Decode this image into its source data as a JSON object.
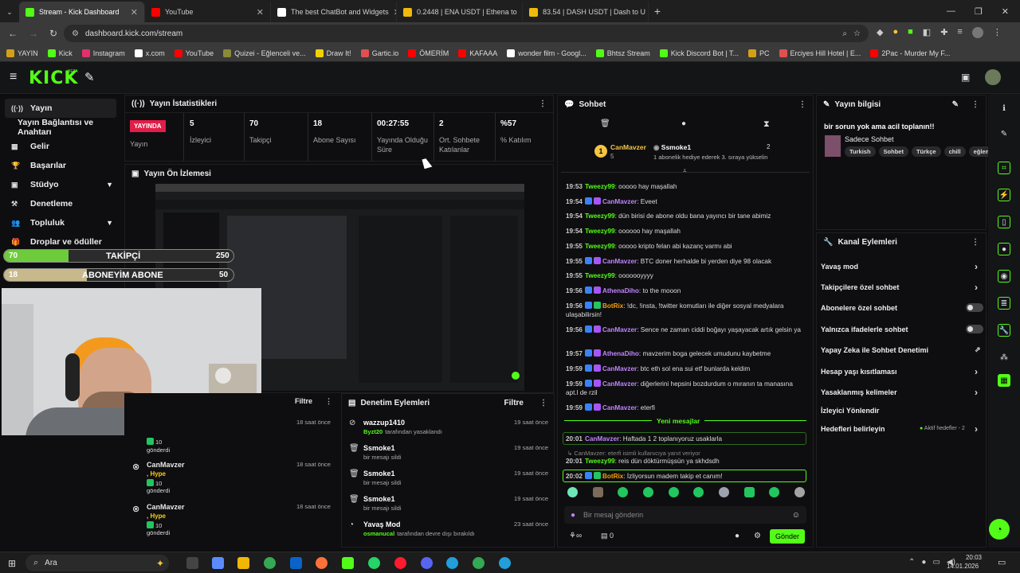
{
  "browser": {
    "tabs": [
      {
        "label": "Stream - Kick Dashboard",
        "color": "#53fc18",
        "active": true
      },
      {
        "label": "YouTube",
        "color": "#ff0000"
      },
      {
        "label": "The best ChatBot and Widgets",
        "color": "#ffffff"
      },
      {
        "label": "0.2448 | ENA USDT | Ethena to",
        "color": "#f0b90b"
      },
      {
        "label": "83.54 | DASH USDT | Dash to U",
        "color": "#f0b90b"
      }
    ],
    "new_tab": "+",
    "url": "dashboard.kick.com/stream",
    "bookmarks": [
      {
        "label": "YAYIN",
        "color": "#d4a017"
      },
      {
        "label": "Kick",
        "color": "#53fc18"
      },
      {
        "label": "Instagram",
        "color": "#e1306c"
      },
      {
        "label": "x.com",
        "color": "#ffffff"
      },
      {
        "label": "YouTube",
        "color": "#ff0000"
      },
      {
        "label": "Quizei - Eğlenceli ve...",
        "color": "#8a8a3a"
      },
      {
        "label": "Draw It!",
        "color": "#f5d000"
      },
      {
        "label": "Gartic.io",
        "color": "#e05050"
      },
      {
        "label": "ÖMERİM",
        "color": "#ff0000"
      },
      {
        "label": "KAFAAA",
        "color": "#ff0000"
      },
      {
        "label": "wonder film - Googl...",
        "color": "#ffffff"
      },
      {
        "label": "Bhtsz Stream",
        "color": "#53fc18"
      },
      {
        "label": "Kick Discord Bot | T...",
        "color": "#53fc18"
      },
      {
        "label": "PC",
        "color": "#d4a017"
      },
      {
        "label": "Erciyes Hill Hotel | E...",
        "color": "#e05050"
      },
      {
        "label": "2Pac - Murder My F...",
        "color": "#ff0000"
      }
    ]
  },
  "app": {
    "logo": "KICK",
    "logo_badge": "BETA"
  },
  "sidebar": {
    "items": [
      {
        "label": "Yayın",
        "icon": "broadcast-icon",
        "active": true
      },
      {
        "label": "Yayın Bağlantısı ve Anahtarı",
        "icon": ""
      },
      {
        "label": "Gelir",
        "icon": "chart-icon"
      },
      {
        "label": "Başarılar",
        "icon": "trophy-icon"
      },
      {
        "label": "Stüdyo",
        "icon": "studio-icon",
        "chevron": true
      },
      {
        "label": "Denetleme",
        "icon": "hammer-icon"
      },
      {
        "label": "Topluluk",
        "icon": "people-icon",
        "chevron": true
      },
      {
        "label": "Droplar ve ödüller",
        "icon": "gift-icon"
      }
    ]
  },
  "overlay": {
    "follow_goal": {
      "current": "70",
      "label": "TAKİPÇİ",
      "target": "250",
      "progress": 0.28
    },
    "sub_goal": {
      "current": "18",
      "label": "ABONEYİM ABONE",
      "target": "50",
      "progress": 0.36
    }
  },
  "stats": {
    "title": "Yayın İstatistikleri",
    "live_badge": "YAYINDA",
    "live_label": "Yayın",
    "items": [
      {
        "value": "5",
        "label": "İzleyici"
      },
      {
        "value": "70",
        "label": "Takipçi"
      },
      {
        "value": "18",
        "label": "Abone Sayısı"
      },
      {
        "value": "00:27:55",
        "label": "Yayında Olduğu Süre"
      },
      {
        "value": "2",
        "label": "Ort. Sohbete Katılanlar"
      },
      {
        "value": "%57",
        "label": "% Katılım"
      }
    ]
  },
  "preview": {
    "title": "Yayın Ön İzlemesi"
  },
  "activity": {
    "filter": "Filtre",
    "items": [
      {
        "time": "18 saat önce",
        "amount": "10",
        "label": "gönderdi"
      },
      {
        "name": "CanMavzer",
        "tag": ", Hype",
        "amount": "10",
        "label": "gönderdi",
        "time": "18 saat önce"
      },
      {
        "name": "CanMavzer",
        "tag": ", Hype",
        "amount": "10",
        "label": "gönderdi",
        "time": "18 saat önce"
      }
    ]
  },
  "moderation": {
    "title": "Denetim Eylemleri",
    "filter": "Filtre",
    "items": [
      {
        "name": "wazzup1410",
        "by": "Byzt20",
        "desc": "tarafından yasaklandı",
        "time": "19 saat önce",
        "icon": "ban-icon"
      },
      {
        "name": "Ssmoke1",
        "desc": "bir mesajı sildi",
        "time": "19 saat önce",
        "icon": "trash-icon"
      },
      {
        "name": "Ssmoke1",
        "desc": "bir mesajı sildi",
        "time": "19 saat önce",
        "icon": "trash-icon"
      },
      {
        "name": "Ssmoke1",
        "desc": "bir mesajı sildi",
        "time": "19 saat önce",
        "icon": "trash-icon"
      },
      {
        "name": "Yavaş Mod",
        "by": "osmanucal",
        "desc": "tarafından devre dışı bırakıldı",
        "time": "23 saat önce",
        "icon": "slow-icon"
      }
    ]
  },
  "chat": {
    "title": "Sohbet",
    "pinned": {
      "user1": "CanMavzer",
      "count1": "5",
      "user2": "Ssmoke1",
      "count2": "2",
      "note": "1 abonelik hediye ederek 3. sıraya yükselin",
      "rank": "1"
    },
    "messages": [
      {
        "time": "19:53",
        "user": "Tweezy99",
        "color": "gn",
        "text": "ooooo hay maşallah"
      },
      {
        "time": "19:54",
        "user": "CanMavzer",
        "color": "pu",
        "text": "Eveet",
        "badges": true
      },
      {
        "time": "19:54",
        "user": "Tweezy99",
        "color": "gn",
        "text": "dün birisi de abone oldu bana yayıncı bir tane abimiz"
      },
      {
        "time": "19:54",
        "user": "Tweezy99",
        "color": "gn",
        "text": "oooooo hay maşallah"
      },
      {
        "time": "19:55",
        "user": "Tweezy99",
        "color": "gn",
        "text": "ooooo kripto felan abi kazanç varmı abi"
      },
      {
        "time": "19:55",
        "user": "CanMavzer",
        "color": "pu",
        "text": "BTC doner herhalde bi yerden diye 98 olacak",
        "badges": true
      },
      {
        "time": "19:55",
        "user": "Tweezy99",
        "color": "gn",
        "text": "ooooooyyyy"
      },
      {
        "time": "19:56",
        "user": "AthenaDiho",
        "color": "pu",
        "text": "to the mooon",
        "badges": true
      },
      {
        "time": "19:56",
        "user": "BotRix",
        "color": "or",
        "text": "!dc, !insta, !twitter komutları ile diğer sosyal medyalara ulaşabilirsin!",
        "badges": true,
        "bot": true
      },
      {
        "time": "19:56",
        "user": "CanMavzer",
        "color": "pu",
        "text": "Sence ne zaman ciddi boğayı yaşayacak artık gelsin ya",
        "badges": true
      },
      {
        "time": "19:57",
        "user": "AthenaDiho",
        "color": "pu",
        "text": "mavzerim boga gelecek umudunu kaybetme",
        "badges": true
      },
      {
        "time": "19:59",
        "user": "CanMavzer",
        "color": "pu",
        "text": "btc eth sol ena sui etf bunlarda keldim",
        "badges": true
      },
      {
        "time": "19:59",
        "user": "CanMavzer",
        "color": "pu",
        "text": "diğerlerini hepsini bozdurdum o mıranın ta manasına apt.l de rzil",
        "badges": true
      },
      {
        "time": "19:59",
        "user": "CanMavzer",
        "color": "pu",
        "text": "eterfi",
        "badges": true
      }
    ],
    "new_messages": "Yeni mesajlar",
    "new": [
      {
        "time": "20:01",
        "user": "CanMavzer",
        "color": "pu",
        "text": "Haftada 1 2 toplanıyoruz usaklarla",
        "highlight": true
      },
      {
        "reply": "CanMavzer: eterfi isimli kullanıcıya yanıt veriyor",
        "time": "20:01",
        "user": "Tweezy99",
        "color": "gn",
        "text": "reis dün döktürmüşsün ya skhdsdh"
      },
      {
        "time": "20:02",
        "user": "BotRix",
        "color": "or",
        "text": "İzliyorsun madem takip et canım!",
        "highlight": true
      }
    ],
    "input_placeholder": "Bir mesaj gönderin",
    "send": "Gönder",
    "footer_count": "0",
    "footer_infinity": "∞"
  },
  "stream_info": {
    "title": "Yayın bilgisi",
    "stream_title": "bir sorun yok ama acil toplanın!!",
    "category": "Sadece Sohbet",
    "tags": [
      "Turkish",
      "Sohbet",
      "Türkçe",
      "chill",
      "eğlen"
    ]
  },
  "channel_actions": {
    "title": "Kanal Eylemleri",
    "items": [
      {
        "label": "Yavaş mod",
        "type": "arrow"
      },
      {
        "label": "Takipçilere özel sohbet",
        "type": "arrow"
      },
      {
        "label": "Abonelere özel sohbet",
        "type": "toggle"
      },
      {
        "label": "Yalnızca ifadelerle sohbet",
        "type": "toggle"
      },
      {
        "label": "Yapay Zeka ile Sohbet Denetimi",
        "type": "external"
      },
      {
        "label": "Hesap yaşı kısıtlaması",
        "type": "arrow"
      },
      {
        "label": "Yasaklanmış kelimeler",
        "type": "arrow"
      },
      {
        "label": "İzleyici Yönlendir",
        "type": "none"
      },
      {
        "label": "Hedefleri belirleyin",
        "type": "arrow",
        "extra": "Aktif hedefler - 2"
      }
    ]
  },
  "taskbar": {
    "search": "Ara",
    "time": "20:03",
    "date": "14.01.2026"
  }
}
